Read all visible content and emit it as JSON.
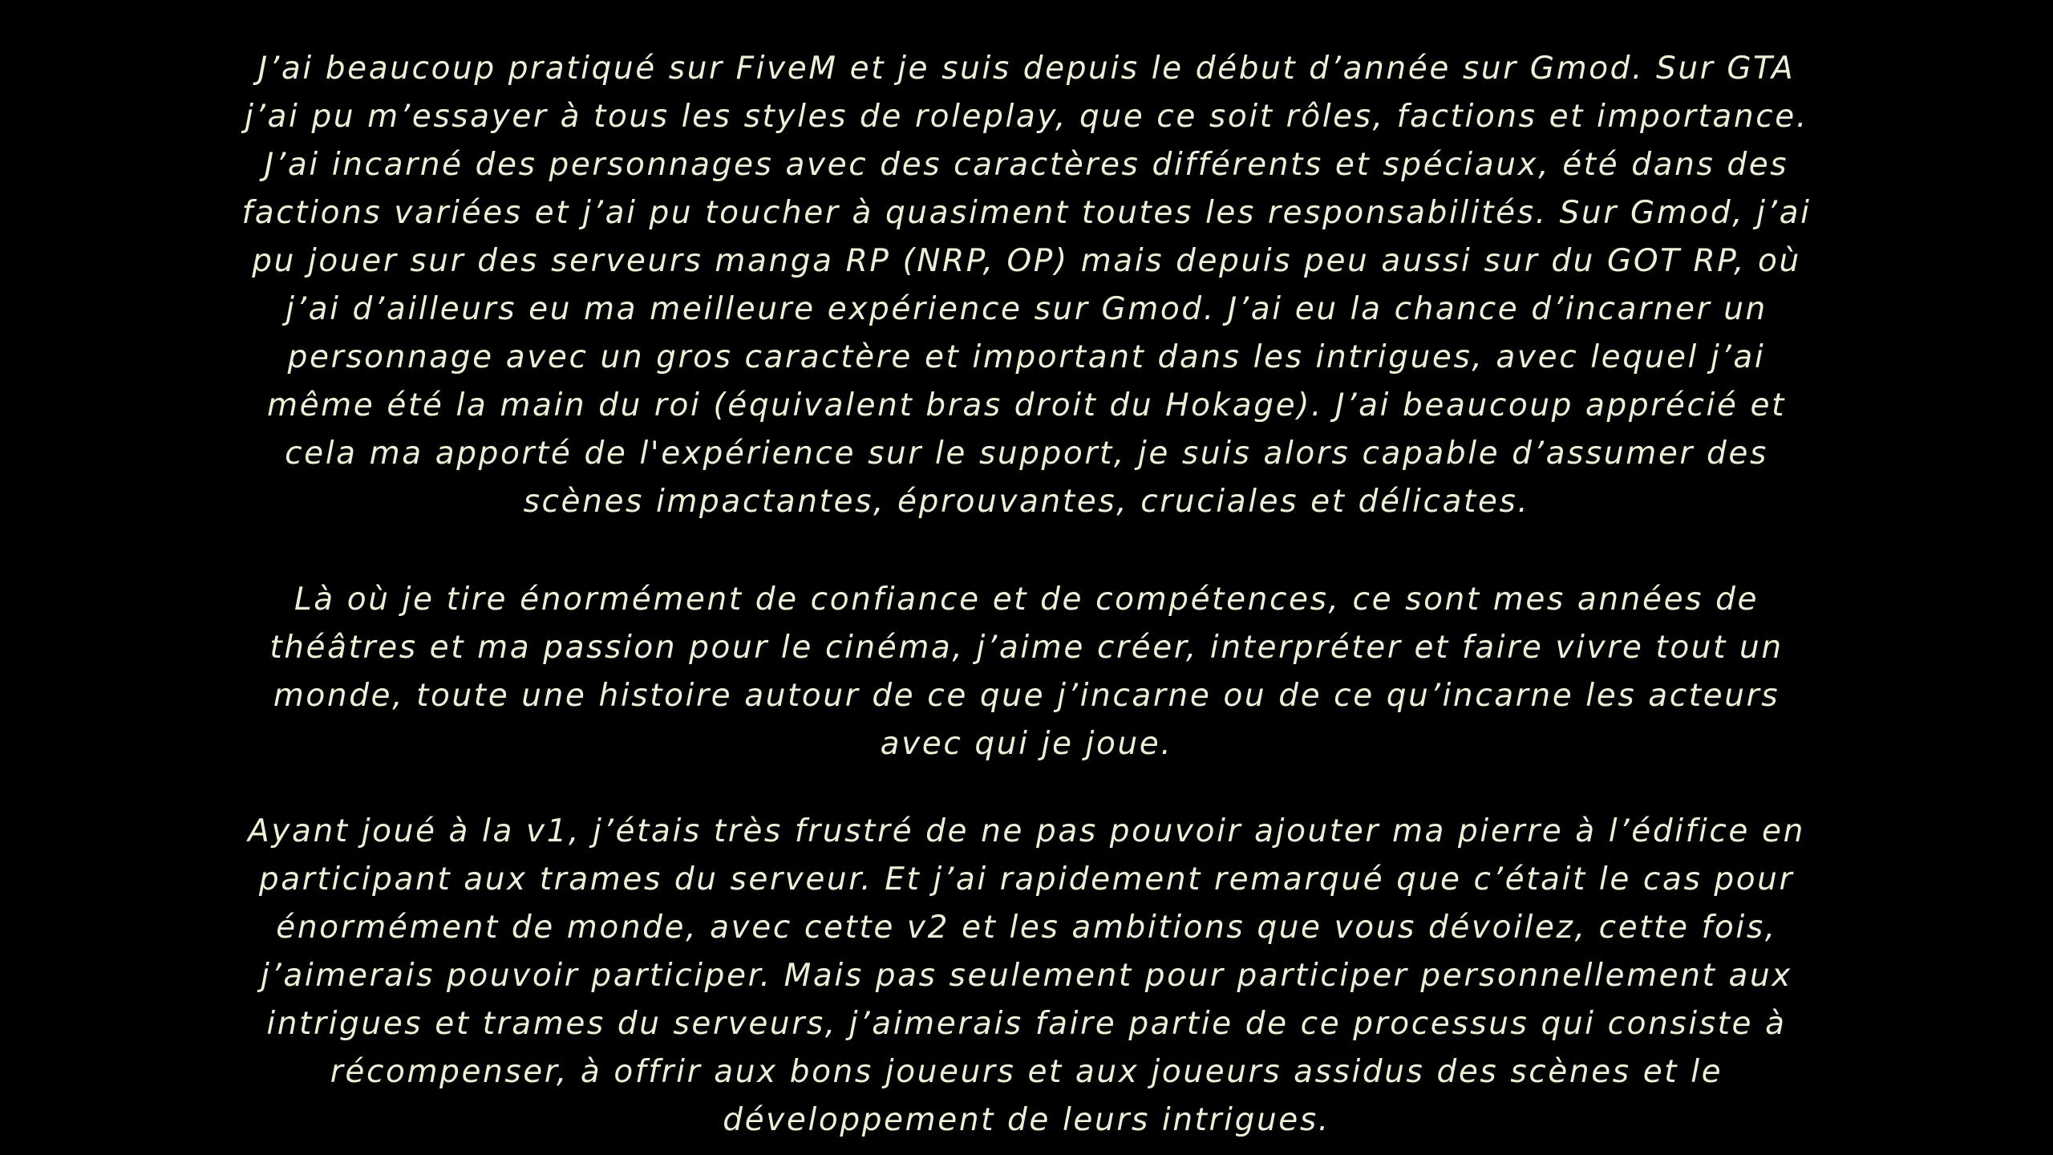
{
  "document": {
    "paragraphs": [
      "J’ai beaucoup pratiqué sur FiveM et je suis depuis le début d’année sur Gmod. Sur GTA\nj’ai pu m’essayer à tous les styles de roleplay, que ce soit rôles, factions et importance.\nJ’ai incarné des personnages avec des caractères différents et spéciaux, été dans des\nfactions variées et j’ai pu toucher à quasiment toutes les responsabilités. Sur Gmod, j’ai\npu jouer sur des serveurs manga RP (NRP, OP) mais depuis peu aussi sur du GOT RP, où\nj’ai d’ailleurs eu ma meilleure expérience sur Gmod. J’ai eu la chance d’incarner un\npersonnage avec un gros caractère et important dans les intrigues, avec lequel j’ai\nmême été la main du roi (équivalent bras droit du Hokage). J’ai beaucoup apprécié et\ncela ma apporté de l'expérience sur le support, je suis alors capable d’assumer des\nscènes impactantes, éprouvantes, cruciales et délicates.",
      "Là où je tire énormément de confiance et de compétences, ce sont mes années de\nthéâtres et ma passion pour le cinéma, j’aime créer, interpréter et faire vivre tout un\nmonde, toute une histoire autour de ce que j’incarne ou de ce qu’incarne les acteurs\navec qui je joue.",
      "Ayant joué à la v1, j’étais très frustré de ne pas pouvoir ajouter ma pierre à l’édifice en\nparticipant aux trames du serveur. Et j’ai rapidement remarqué que c’était le cas pour\nénormément de monde, avec cette v2 et les ambitions que vous dévoilez, cette fois,\nj’aimerais pouvoir participer. Mais pas seulement pour participer personnellement aux\nintrigues et trames du serveurs, j’aimerais faire partie de ce processus qui consiste à\nrécompenser, à offrir aux bons joueurs et aux joueurs assidus des scènes et le\ndéveloppement de leurs intrigues."
    ]
  },
  "colors": {
    "background": "#000000",
    "text": "#ecf0d6"
  }
}
